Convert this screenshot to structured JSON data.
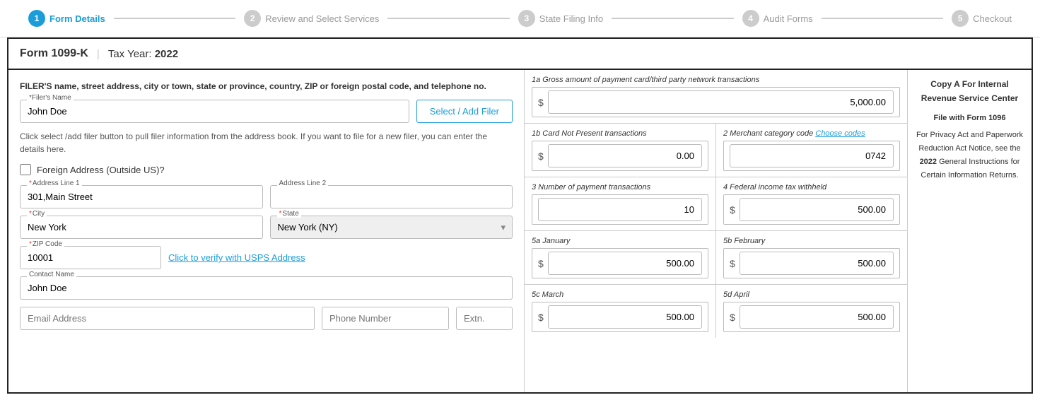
{
  "stepper": {
    "steps": [
      {
        "number": "1",
        "label": "Form Details",
        "state": "active"
      },
      {
        "number": "2",
        "label": "Review and Select Services",
        "state": "inactive"
      },
      {
        "number": "3",
        "label": "State Filing Info",
        "state": "inactive"
      },
      {
        "number": "4",
        "label": "Audit Forms",
        "state": "inactive"
      },
      {
        "number": "5",
        "label": "Checkout",
        "state": "inactive"
      }
    ]
  },
  "form_header": {
    "form_name": "Form 1099-K",
    "divider": "|",
    "tax_year_label": "Tax Year:",
    "tax_year_value": "2022"
  },
  "left_panel": {
    "filer_address_label": "FILER'S name, street address, city or town, state or province, country, ZIP or foreign postal code, and telephone no.",
    "filer_name_label": "*Filer's Name",
    "filer_name_value": "John Doe",
    "select_add_filer_btn": "Select / Add Filer",
    "info_text": "Click select /add filer button to pull filer information from the address book. If you want to file for a new filer, you can enter the details here.",
    "foreign_address_label": "Foreign Address (Outside US)?",
    "address_line1_label": "*Address Line 1",
    "address_line1_value": "301,Main Street",
    "address_line2_label": "Address Line 2",
    "address_line2_value": "",
    "city_label": "*City",
    "city_value": "New York",
    "state_label": "*State",
    "state_value": "New York (NY)",
    "zip_label": "*ZIP Code",
    "zip_value": "10001",
    "verify_link": "Click to verify with USPS Address",
    "contact_name_label": "Contact Name",
    "contact_name_value": "John Doe",
    "email_placeholder": "Email Address",
    "phone_placeholder": "Phone Number",
    "extn_placeholder": "Extn."
  },
  "right_panel": {
    "field_1a_label": "1a  Gross amount of payment card/third party network transactions",
    "field_1a_value": "5,000.00",
    "field_1b_label": "1b  Card Not Present transactions",
    "field_1b_value": "0.00",
    "field_2_label": "2   Merchant category code",
    "field_2_choose_codes": "Choose codes",
    "field_2_value": "0742",
    "field_3_label": "3   Number of payment transactions",
    "field_3_value": "10",
    "field_4_label": "4   Federal income tax withheld",
    "field_4_value": "500.00",
    "field_5a_label": "5a  January",
    "field_5a_value": "500.00",
    "field_5b_label": "5b  February",
    "field_5b_value": "500.00",
    "field_5c_label": "5c  March",
    "field_5c_value": "500.00",
    "field_5d_label": "5d  April",
    "field_5d_value": "500.00"
  },
  "copy_a_panel": {
    "title": "Copy A For Internal Revenue Service Center",
    "file_with": "File with Form 1096",
    "notice": "For Privacy Act and Paperwork Reduction Act Notice, see the",
    "bold_text": "2022 General Instructions for Certain Information Returns.",
    "year": "2022"
  }
}
